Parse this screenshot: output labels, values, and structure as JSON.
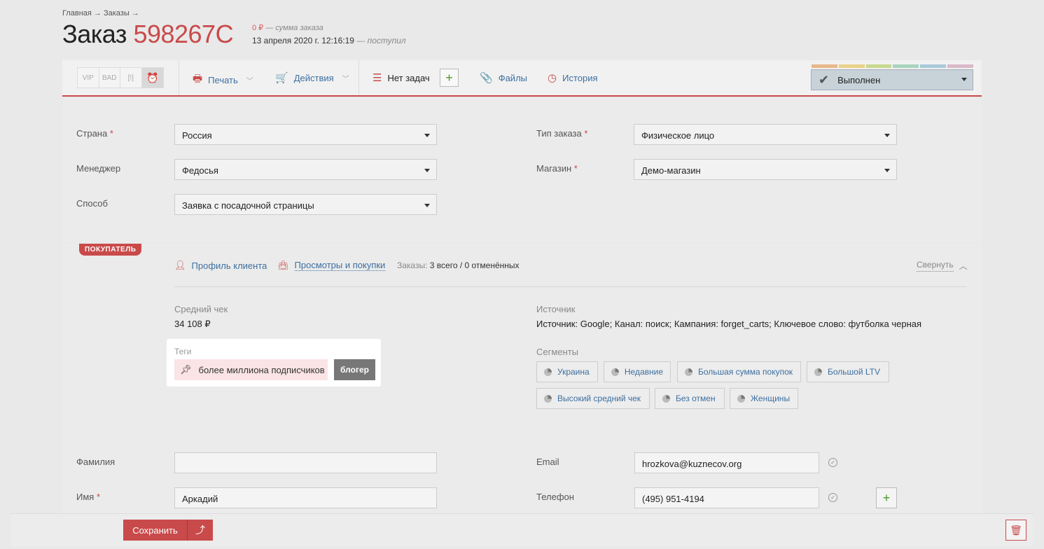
{
  "header": {
    "breadcrumb": "Главная → Заказы →",
    "title_prefix": "Заказ",
    "order_number": "598267C",
    "sum_value": "0 ₽",
    "sum_caption": "— сумма заказа",
    "date_value": "13 апреля 2020 г. 12:16:19",
    "date_caption": "— поступил"
  },
  "toolbar": {
    "flags": [
      "VIP",
      "BAD",
      "[!]",
      "⏰"
    ],
    "print_label": "Печать",
    "actions_label": "Действия",
    "tasks_label": "Нет задач",
    "add_task_symbol": "+",
    "files_label": "Файлы",
    "history_label": "История",
    "status_label": "Выполнен",
    "status_strip_colors": [
      "#e8b88a",
      "#e9d28a",
      "#c8d98e",
      "#a9d4be",
      "#a9c9d9",
      "#d9b9c9"
    ]
  },
  "form": {
    "country_label": "Страна",
    "country_value": "Россия",
    "manager_label": "Менеджер",
    "manager_value": "Федосья",
    "method_label": "Способ",
    "method_value": "Заявка с посадочной страницы",
    "order_type_label": "Тип заказа",
    "order_type_value": "Физическое лицо",
    "shop_label": "Магазин",
    "shop_value": "Демо-магазин",
    "required_mark": "*"
  },
  "buyer": {
    "badge": "ПОКУПАТЕЛЬ",
    "profile_link": "Профиль клиента",
    "views_link": "Просмотры и покупки",
    "orders_caption": "Заказы:",
    "orders_value": "3 всего / 0 отменённых",
    "collapse_label": "Свернуть",
    "avg_check_label": "Средний чек",
    "avg_check_value": "34 108 ₽",
    "source_label": "Источник",
    "source_value": "Источник: Google; Канал: поиск; Кампания: forget_carts; Ключевое слово: футболка черная",
    "tags_label": "Теги",
    "tags": [
      "более миллиона подписчиков",
      "блогер"
    ],
    "segments_label": "Сегменты",
    "segments_row1": [
      "Украина",
      "Недавние",
      "Большая сумма покупок",
      "Большой LTV"
    ],
    "segments_row2": [
      "Высокий средний чек",
      "Без отмен",
      "Женщины"
    ],
    "lastname_label": "Фамилия",
    "lastname_value": "",
    "firstname_label": "Имя",
    "firstname_value": "Аркадий",
    "email_label": "Email",
    "email_value": "hrozkova@kuznecov.org",
    "phone_label": "Телефон",
    "phone_value": "(495) 951-4194",
    "add_phone_symbol": "+"
  },
  "footer": {
    "save_label": "Сохранить",
    "save_up_symbol": "⤴",
    "trash_symbol": "🗑"
  },
  "colors": {
    "accent": "#c94a4a",
    "link": "#3d6fa0",
    "status_bg": "#c7d3d9"
  }
}
